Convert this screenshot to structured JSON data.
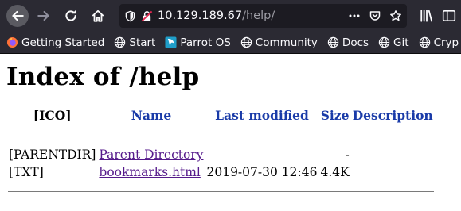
{
  "browser": {
    "url_host": "10.129.189.67",
    "url_path": "/help/",
    "bookmarks": [
      {
        "label": "Getting Started",
        "icon": "firefox-icon"
      },
      {
        "label": "Start",
        "icon": "globe-icon"
      },
      {
        "label": "Parrot OS",
        "icon": "parrot-icon"
      },
      {
        "label": "Community",
        "icon": "globe-icon"
      },
      {
        "label": "Docs",
        "icon": "globe-icon"
      },
      {
        "label": "Git",
        "icon": "globe-icon"
      },
      {
        "label": "Cryp",
        "icon": "globe-icon"
      }
    ]
  },
  "page": {
    "title": "Index of /help",
    "columns": {
      "icon": "[ICO]",
      "name": "Name",
      "last_modified": "Last modified",
      "size": "Size",
      "description": "Description"
    },
    "rows": [
      {
        "icon": "[PARENTDIR]",
        "name": "Parent Directory",
        "last_modified": "",
        "size": "-",
        "description": ""
      },
      {
        "icon": "[TXT]",
        "name": "bookmarks.html",
        "last_modified": "2019-07-30 12:46",
        "size": "4.4K",
        "description": ""
      }
    ]
  }
}
